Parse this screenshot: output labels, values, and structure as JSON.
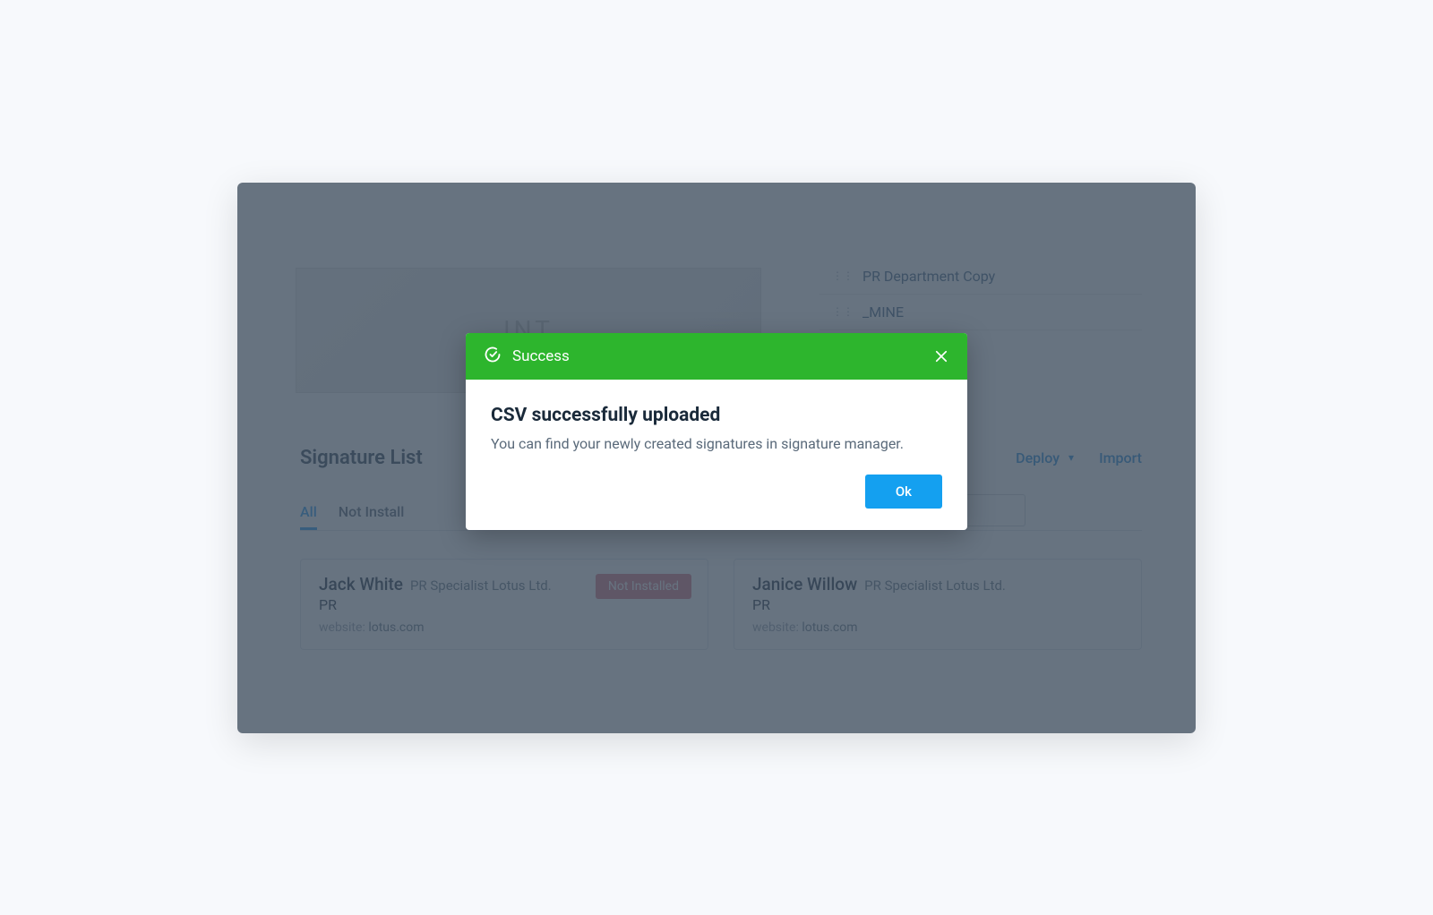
{
  "modal": {
    "header_label": "Success",
    "title": "CSV successfully uploaded",
    "description": "You can find your newly created signatures in signature manager.",
    "ok_label": "Ok"
  },
  "bg": {
    "logo_text": "INT",
    "sidebar_items": [
      {
        "label": "PR Department Copy"
      },
      {
        "label": "_MINE"
      }
    ],
    "section_title": "Signature List",
    "actions": {
      "deploy": "Deploy",
      "import": "Import"
    },
    "tabs": [
      {
        "label": "All",
        "active": true
      },
      {
        "label": "Not Install",
        "active": false
      }
    ],
    "cards": [
      {
        "name": "Jack White",
        "role": "PR Specialist Lotus Ltd.",
        "dept": "PR",
        "website_label": "website:",
        "website_value": "lotus.com",
        "badge": "Not Installed"
      },
      {
        "name": "Janice Willow",
        "role": "PR Specialist Lotus Ltd.",
        "dept": "PR",
        "website_label": "website:",
        "website_value": "lotus.com",
        "badge": ""
      }
    ]
  }
}
